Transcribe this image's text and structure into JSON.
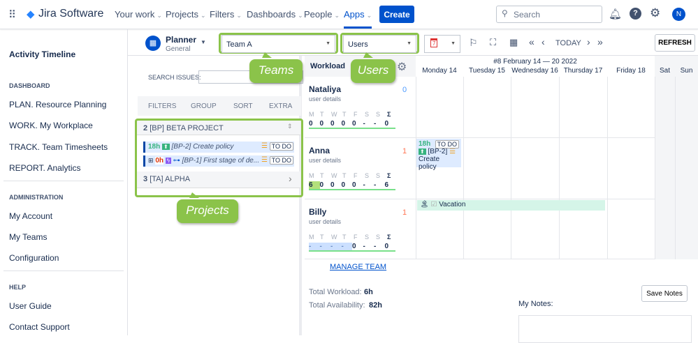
{
  "topnav": {
    "product": "Jira Software",
    "items": [
      "Your work",
      "Projects",
      "Filters",
      "Dashboards",
      "People",
      "Apps"
    ],
    "create": "Create",
    "search_placeholder": "Search",
    "avatar": "N",
    "accent": "#0052cc"
  },
  "sidebar": {
    "title": "Activity Timeline",
    "sections": [
      {
        "heading": "DASHBOARD",
        "items": [
          "PLAN. Resource Planning",
          "WORK. My Workplace",
          "TRACK. Team Timesheets",
          "REPORT. Analytics"
        ]
      },
      {
        "heading": "ADMINISTRATION",
        "items": [
          "My Account",
          "My Teams",
          "Configuration"
        ]
      },
      {
        "heading": "HELP",
        "items": [
          "User Guide",
          "Contact Support"
        ]
      }
    ]
  },
  "toolbar": {
    "planner": "Planner",
    "planner_sub": "General",
    "team": "Team A",
    "users": "Users",
    "calendar_day": "7",
    "today": "TODAY",
    "refresh": "REFRESH"
  },
  "callouts": {
    "teams": "Teams",
    "users": "Users",
    "projects": "Projects"
  },
  "issues": {
    "search_label": "SEARCH ISSUES:",
    "tabs": [
      "FILTERS",
      "GROUP",
      "SORT",
      "EXTRA"
    ],
    "projects": [
      {
        "count": "2",
        "name": "[BP] BETA PROJECT",
        "issues": [
          {
            "hours": "18h",
            "key": "[BP-2] Create policy",
            "status": "TO DO"
          },
          {
            "hours": "0h",
            "key": "[BP-1] First stage of de...",
            "status": "TO DO"
          }
        ]
      },
      {
        "count": "3",
        "name": "[TA] ALPHA"
      }
    ]
  },
  "workload": {
    "title": "Workload",
    "days": [
      "M",
      "T",
      "W",
      "T",
      "F",
      "S",
      "S",
      "Σ"
    ],
    "users": [
      {
        "name": "Nataliya",
        "details": "user details",
        "count": "0",
        "values": [
          "0",
          "0",
          "0",
          "0",
          "0",
          "-",
          "-",
          "0"
        ]
      },
      {
        "name": "Anna",
        "details": "user details",
        "count": "1",
        "values": [
          "6",
          "0",
          "0",
          "0",
          "0",
          "-",
          "-",
          "6"
        ]
      },
      {
        "name": "Billy",
        "details": "user details",
        "count": "1",
        "values": [
          "-",
          "-",
          "-",
          "-",
          "0",
          "-",
          "-",
          "0"
        ]
      }
    ],
    "manage": "MANAGE TEAM",
    "total_workload_label": "Total Workload:",
    "total_workload": "6h",
    "total_avail_label": "Total Availability:",
    "total_avail": "82h"
  },
  "calendar": {
    "week": "#8 February 14 — 20 2022",
    "days": [
      "Monday 14",
      "Tuesday 15",
      "Wednesday 16",
      "Thursday 17",
      "Friday 18",
      "Sat",
      "Sun"
    ],
    "event": {
      "hours": "18h",
      "status": "TO DO",
      "key": "[BP-2]",
      "title": "Create policy"
    },
    "vacation": "Vacation"
  },
  "notes": {
    "label": "My Notes:",
    "save": "Save Notes"
  }
}
